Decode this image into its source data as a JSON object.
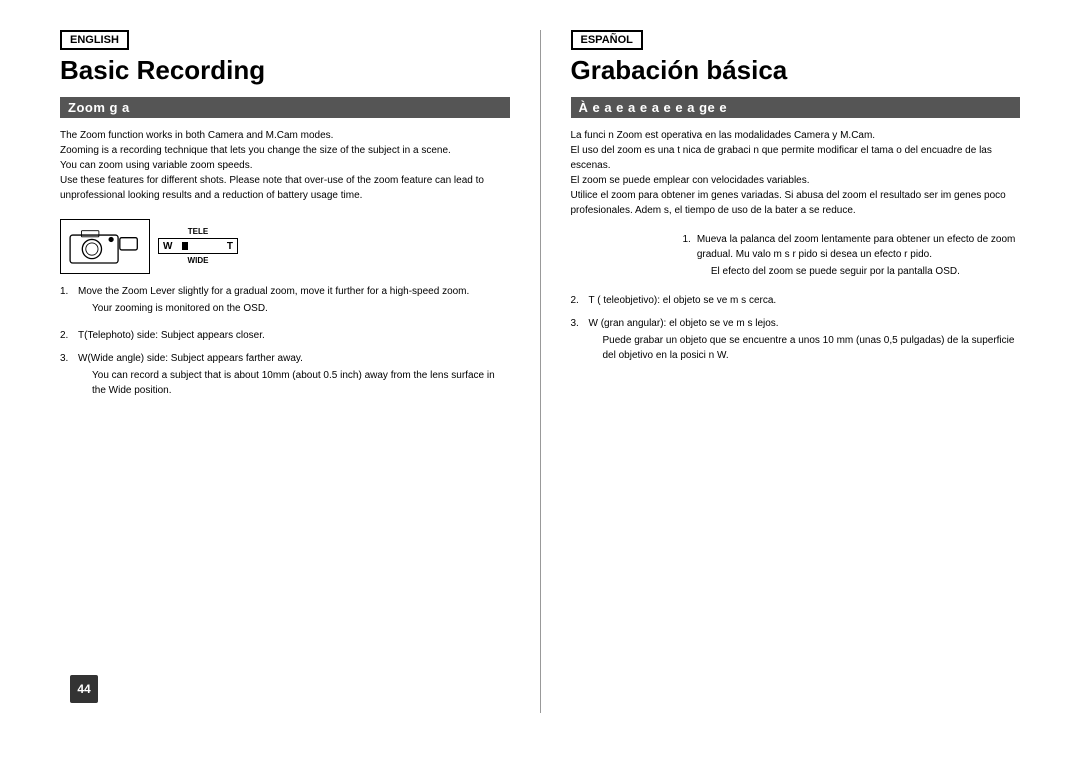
{
  "left": {
    "lang_badge": "ENGLISH",
    "title": "Basic Recording",
    "subtitle": "Zoom g a",
    "body": [
      "The Zoom function works in both Camera and M.Cam modes.",
      "Zooming is a recording technique that lets you change the size of the subject in a scene.",
      "You can zoom using variable zoom speeds.",
      "Use these features for different shots. Please note that over-use of the zoom feature can lead to unprofessional looking results and a reduction of battery usage time."
    ],
    "steps": [
      {
        "num": "1.",
        "main": "Move the Zoom Lever slightly for a gradual zoom, move it further for a high-speed zoom.",
        "sub": "Your zooming is monitored on the OSD."
      },
      {
        "num": "2.",
        "main": "T(Telephoto) side: Subject appears closer.",
        "sub": ""
      },
      {
        "num": "3.",
        "main": "W(Wide angle) side: Subject appears farther away.",
        "sub": "You can record a subject that is about 10mm (about 0.5 inch) away from the lens surface in the Wide position."
      }
    ],
    "zoom_label_top": "TELE",
    "zoom_label_bottom": "WIDE",
    "zoom_left": "W",
    "zoom_right": "T"
  },
  "right": {
    "lang_badge": "ESPAÑOL",
    "title": "Grabación básica",
    "subtitle": "À e a e a e a e e a ge e",
    "body": [
      "La funci n Zoom est  operativa en las modalidades Camera y M.Cam.",
      "El uso del zoom es una t nica de grabaci n que permite modificar el tama o del encuadre de las escenas.",
      "El zoom se puede emplear con velocidades variables.",
      "Utilice el zoom para obtener im genes variadas. Si abusa del zoom el resultado ser  im genes poco profesionales. Adem s, el tiempo de uso de la bater a se reduce."
    ],
    "steps": [
      {
        "num": "1.",
        "main": "Mueva la palanca del zoom lentamente para obtener un efecto de zoom gradual. Mu valo m s r pido si desea un efecto r pido.",
        "sub": "El efecto del zoom se puede seguir por la pantalla OSD."
      },
      {
        "num": "2.",
        "main": "T ( teleobjetivo): el objeto se ve m s cerca.",
        "sub": ""
      },
      {
        "num": "3.",
        "main": "W (gran angular): el objeto se ve m s lejos.",
        "sub": "Puede grabar un objeto que se encuentre a unos 10 mm (unas 0,5 pulgadas) de la superficie del objetivo en la posici n W."
      }
    ]
  },
  "page_number": "44"
}
